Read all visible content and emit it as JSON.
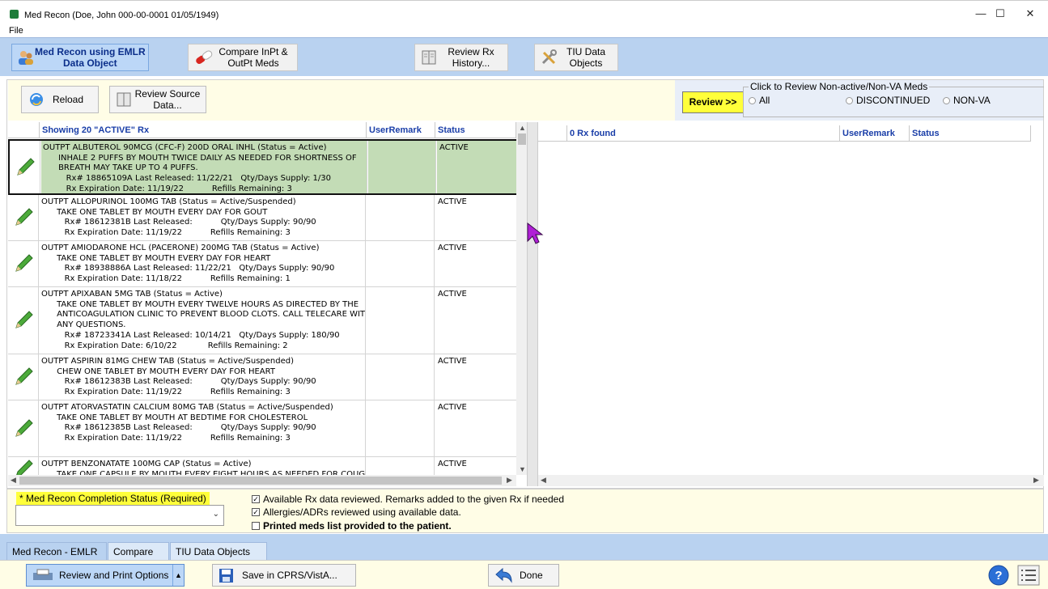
{
  "window": {
    "title": "Med Recon (Doe, John  000-00-0001  01/05/1949)",
    "menu_file": "File",
    "minimize": "—",
    "maximize": "☐",
    "close": "✕"
  },
  "toolbar": {
    "btn1": "Med Recon using EMLR\nData Object",
    "btn2": "Compare InPt &\nOutPt Meds",
    "btn3": "Review Rx\nHistory...",
    "btn4": "TIU Data\nObjects"
  },
  "actions": {
    "reload": "Reload",
    "review_source": "Review Source\nData..."
  },
  "review": {
    "button": "Review >>",
    "legend": "Click to Review Non-active/Non-VA  Meds",
    "opt_all": "All",
    "opt_discontinued": "DISCONTINUED",
    "opt_nonva": "NON-VA"
  },
  "left_grid": {
    "headers": [
      "Showing 20 \"ACTIVE\" Rx",
      "UserRemark",
      "Status"
    ],
    "rows": [
      {
        "text": "OUTPT ALBUTEROL 90MCG (CFC-F) 200D ORAL INHL (Status = Active)\n      INHALE 2 PUFFS BY MOUTH TWICE DAILY AS NEEDED FOR SHORTNESS OF\n      BREATH MAY TAKE UP TO 4 PUFFS.\n         Rx# 18865109A Last Released: 11/22/21   Qty/Days Supply: 1/30\n         Rx Expiration Date: 11/19/22           Refills Remaining: 3",
        "status": "ACTIVE"
      },
      {
        "text": "OUTPT ALLOPURINOL 100MG TAB (Status = Active/Suspended)\n      TAKE ONE TABLET BY MOUTH EVERY DAY FOR GOUT\n         Rx# 18612381B Last Released:           Qty/Days Supply: 90/90\n         Rx Expiration Date: 11/19/22           Refills Remaining: 3",
        "status": "ACTIVE"
      },
      {
        "text": "OUTPT AMIODARONE HCL (PACERONE) 200MG TAB (Status = Active)\n      TAKE ONE TABLET BY MOUTH EVERY DAY FOR HEART\n         Rx# 18938886A Last Released: 11/22/21   Qty/Days Supply: 90/90\n         Rx Expiration Date: 11/18/22           Refills Remaining: 1",
        "status": "ACTIVE"
      },
      {
        "text": "OUTPT APIXABAN 5MG TAB (Status = Active)\n      TAKE ONE TABLET BY MOUTH EVERY TWELVE HOURS AS DIRECTED BY THE\n      ANTICOAGULATION CLINIC TO PREVENT BLOOD CLOTS. CALL TELECARE WITH\n      ANY QUESTIONS.\n         Rx# 18723341A Last Released: 10/14/21   Qty/Days Supply: 180/90\n         Rx Expiration Date: 6/10/22            Refills Remaining: 2",
        "status": "ACTIVE"
      },
      {
        "text": "OUTPT ASPIRIN 81MG CHEW TAB (Status = Active/Suspended)\n      CHEW ONE TABLET BY MOUTH EVERY DAY FOR HEART\n         Rx# 18612383B Last Released:           Qty/Days Supply: 90/90\n         Rx Expiration Date: 11/19/22           Refills Remaining: 3",
        "status": "ACTIVE"
      },
      {
        "text": "OUTPT ATORVASTATIN CALCIUM 80MG TAB (Status = Active/Suspended)\n      TAKE ONE TABLET BY MOUTH AT BEDTIME FOR CHOLESTEROL\n         Rx# 18612385B Last Released:           Qty/Days Supply: 90/90\n         Rx Expiration Date: 11/19/22           Refills Remaining: 3",
        "status": "ACTIVE"
      },
      {
        "text": "OUTPT BENZONATATE 100MG CAP (Status = Active)\n      TAKE ONE CAPSULE BY MOUTH EVERY EIGHT HOURS AS NEEDED FOR COUGH",
        "status": "ACTIVE"
      }
    ]
  },
  "right_grid": {
    "headers": [
      "0 Rx found",
      "UserRemark",
      "Status"
    ]
  },
  "completion": {
    "label_prefix": "* Med Recon Completion Status ",
    "label_required": "(Required)",
    "select_value": "",
    "check1": "Available Rx data reviewed. Remarks added to the given Rx if needed",
    "check2": "Allergies/ADRs reviewed using available data.",
    "check3": "Printed meds list provided to the patient."
  },
  "tabs": [
    "Med Recon - EMLR",
    "Compare",
    "TIU Data Objects"
  ],
  "footer": {
    "review_print": "Review and Print Options",
    "save": "Save in CPRS/VistA...",
    "done": "Done"
  },
  "colors": {
    "toolbar": "#b9d2f0",
    "header_text": "#1a3ea8",
    "selected_row": "#c3dcb6",
    "highlight_yellow": "#ffff3a"
  }
}
